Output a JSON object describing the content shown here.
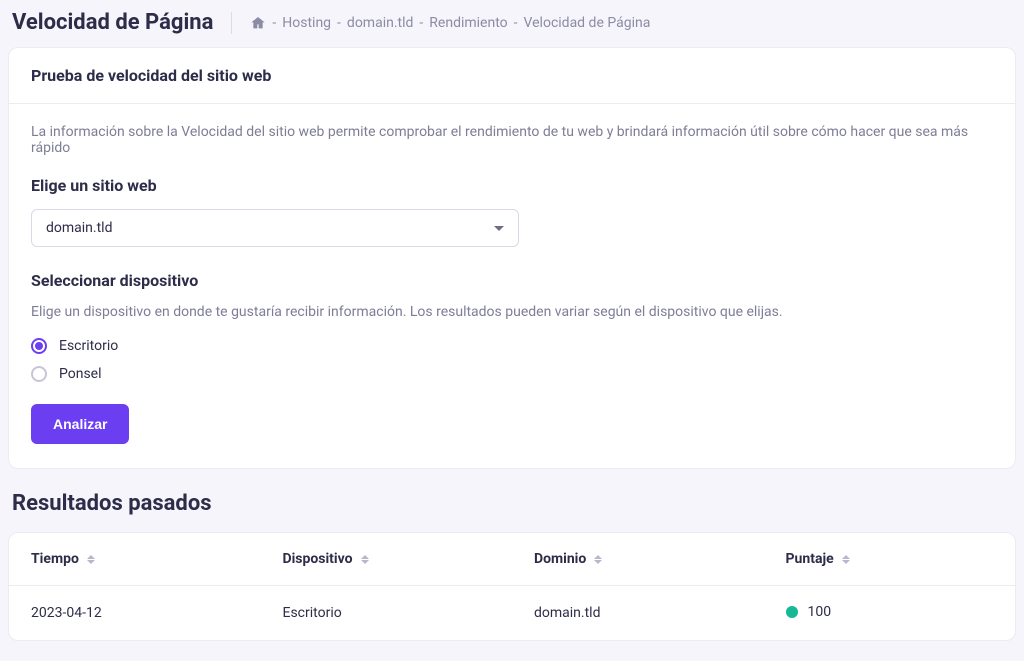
{
  "page_title": "Velocidad de Página",
  "breadcrumb": {
    "items": [
      {
        "label": "Hosting"
      },
      {
        "label": "domain.tld"
      },
      {
        "label": "Rendimiento"
      },
      {
        "label": "Velocidad de Página"
      }
    ]
  },
  "speed_card": {
    "title": "Prueba de velocidad del sitio web",
    "description": "La información sobre la Velocidad del sitio web permite comprobar el rendimiento de tu web y brindará información útil sobre cómo hacer que sea más rápido",
    "choose_site_label": "Elige un sitio web",
    "site_selected": "domain.tld",
    "device_label": "Seleccionar dispositivo",
    "device_desc": "Elige un dispositivo en donde te gustaría recibir información. Los resultados pueden variar según el dispositivo que elijas.",
    "device_options": [
      {
        "label": "Escritorio",
        "checked": true
      },
      {
        "label": "Ponsel",
        "checked": false
      }
    ],
    "analyze_label": "Analizar"
  },
  "results": {
    "title": "Resultados pasados",
    "columns": {
      "time": "Tiempo",
      "device": "Dispositivo",
      "domain": "Dominio",
      "score": "Puntaje"
    },
    "rows": [
      {
        "time": "2023-04-12",
        "device": "Escritorio",
        "domain": "domain.tld",
        "score": "100",
        "score_color": "green"
      }
    ]
  }
}
